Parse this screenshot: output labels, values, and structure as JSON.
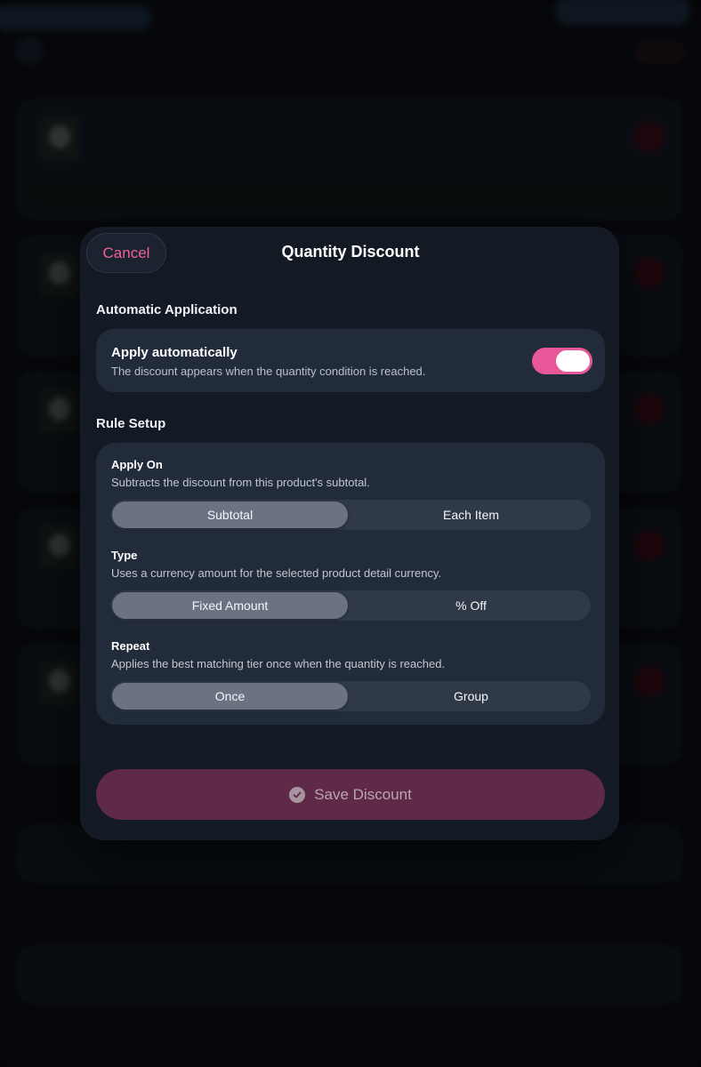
{
  "modal": {
    "cancel_label": "Cancel",
    "title": "Quantity Discount"
  },
  "automatic": {
    "section_title": "Automatic Application",
    "row_title": "Apply automatically",
    "row_description": "The discount appears when the quantity condition is reached.",
    "enabled": true
  },
  "rules": {
    "section_title": "Rule Setup",
    "apply_on": {
      "title": "Apply On",
      "description": "Subtracts the discount from this product's subtotal.",
      "options": [
        "Subtotal",
        "Each Item"
      ],
      "selected": "Subtotal"
    },
    "type": {
      "title": "Type",
      "description": "Uses a currency amount for the selected product detail currency.",
      "options": [
        "Fixed Amount",
        "% Off"
      ],
      "selected": "Fixed Amount"
    },
    "repeat": {
      "title": "Repeat",
      "description": "Applies the best matching tier once when the quantity is reached.",
      "options": [
        "Once",
        "Group"
      ],
      "selected": "Once"
    }
  },
  "save_label": "Save Discount",
  "colors": {
    "accent_pink": "#e85797",
    "cancel_text": "#f2609a",
    "save_button_bg": "#5e2a47",
    "card_bg": "#222b3a",
    "modal_bg": "#141a24"
  }
}
